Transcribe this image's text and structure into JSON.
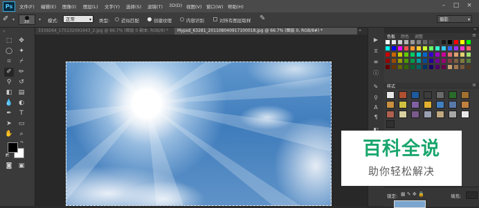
{
  "app": {
    "logo": "Ps"
  },
  "menu": [
    "文件(F)",
    "编辑(E)",
    "图像(I)",
    "图层(L)",
    "文字(Y)",
    "选择(S)",
    "滤镜(T)",
    "3D(D)",
    "视图(V)",
    "窗口(W)",
    "帮助(H)"
  ],
  "window_controls": [
    "–",
    "□",
    "×"
  ],
  "options": {
    "brush_size": "20",
    "mode_label": "模式:",
    "mode_value": "正常",
    "type_label": "类型:",
    "type_options": [
      "近似匹配",
      "创建纹理",
      "内容识别"
    ],
    "type_selected": "创建纹理",
    "sample_all_label": "对所有图层取样",
    "workspace": "摄影"
  },
  "tabs": [
    {
      "label": "3339264_175132091643_2.jpg @ 66.7% (图层 0 副本, RGB/8) *",
      "active": false
    },
    {
      "label": "Mypsd_63281_201108040917100018.jpg @ 66.7% (图层 0, RGB/8#) *",
      "active": true
    }
  ],
  "panels": {
    "color_tabs": [
      "色板",
      "颜色",
      "调整"
    ],
    "styles_title": "样式",
    "layers_lock_label": "锁定:",
    "layers_fill_label": "填充:",
    "swatch_colors": [
      "#ffffff",
      "#e6e6e6",
      "#cccccc",
      "#b3b3b3",
      "#999999",
      "#808080",
      "#666666",
      "#4d4d4d",
      "#333333",
      "#1a1a1a",
      "#000000",
      "#ff0000",
      "#ffff00",
      "#00ff00",
      "#00ffff",
      "#0000ff",
      "#ff00ff",
      "#ff4d4d",
      "#ff9933",
      "#ffcc33",
      "#ccff33",
      "#66ff66",
      "#33ffcc",
      "#33ccff",
      "#3366ff",
      "#9933ff",
      "#ff33cc",
      "#ff6666",
      "#cc0000",
      "#cc6600",
      "#cccc00",
      "#66cc00",
      "#00cc66",
      "#00cccc",
      "#0066cc",
      "#3300cc",
      "#9900cc",
      "#cc0099",
      "#e07070",
      "#e0a070",
      "#e0d070",
      "#a0e070",
      "#990000",
      "#994c00",
      "#999900",
      "#4c9900",
      "#00994c",
      "#009999",
      "#004c99",
      "#260099",
      "#730099",
      "#990073",
      "#804040",
      "#806040",
      "#807a40",
      "#5a8040",
      "#660000",
      "#663300",
      "#666600",
      "#336600",
      "#006633",
      "#006666",
      "#003366",
      "#1a0066",
      "#4d0066",
      "#66004d",
      "#c8a070",
      "#a07850",
      "#785838",
      "#503820"
    ],
    "style_colors": [
      "#e8e8e8",
      "#b05030",
      "#1e5a9e",
      "#3c3c3c",
      "#6a6a6a",
      "#2a6a2a",
      "#a07030",
      "#c89040",
      "#d0c040",
      "#8060a0",
      "#e0b030",
      "#4080c0",
      "#5878a8",
      "#c08040",
      "#b06050",
      "#d8d0a0",
      "#7a5a8a",
      "#9aa0b0",
      "#c0a880",
      "#a8a8a8",
      "#e8e8e8",
      "#303030"
    ]
  },
  "watermark": {
    "title": "百科全说",
    "subtitle": "助你轻松解决"
  }
}
